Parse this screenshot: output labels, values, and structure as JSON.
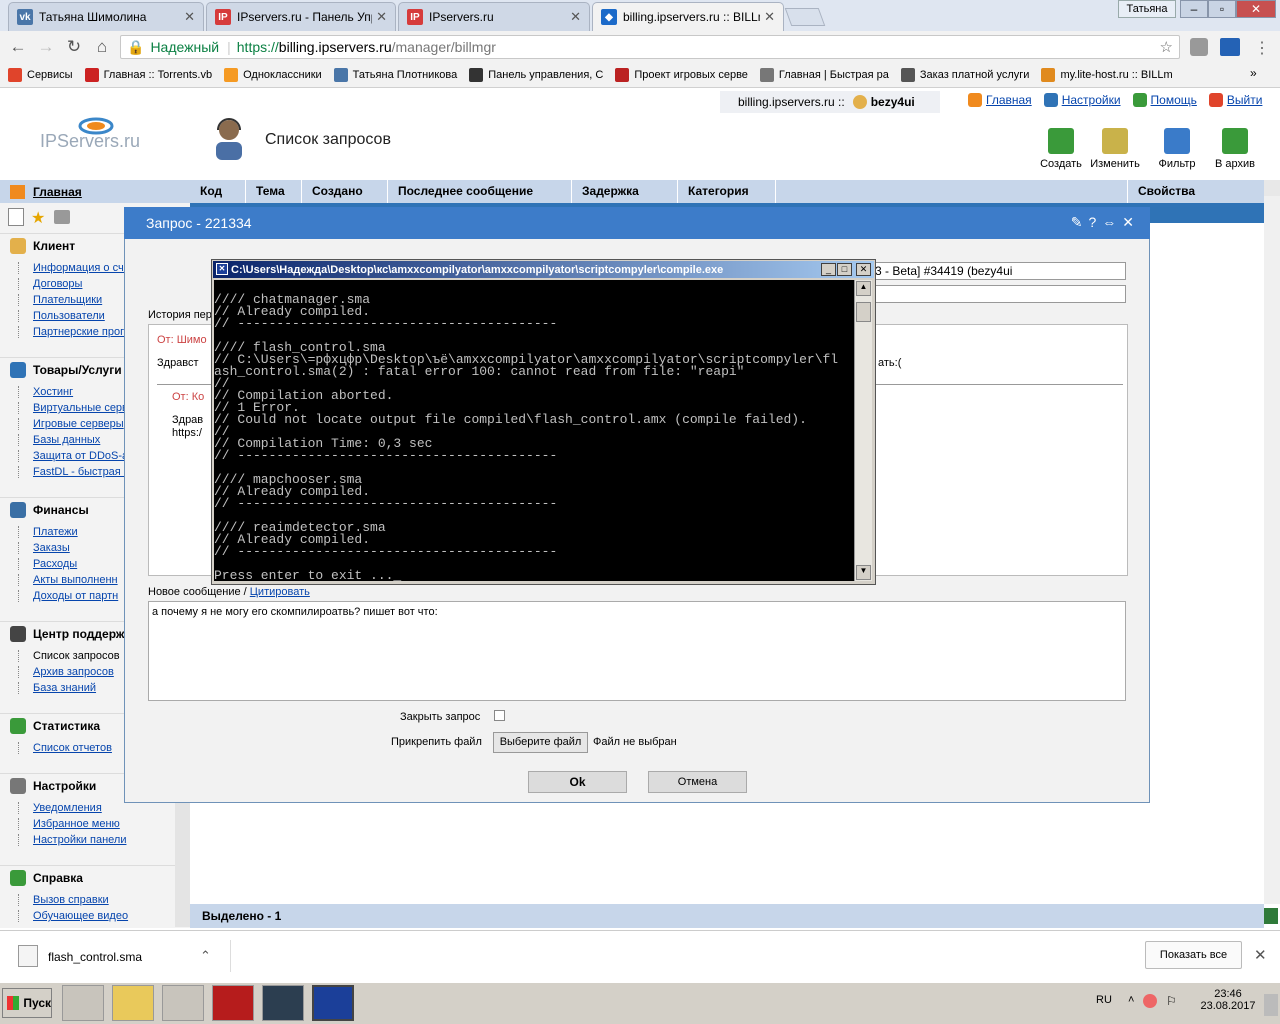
{
  "browser": {
    "tabs": [
      {
        "title": "Татьяна Шимолина",
        "color": "#4a76a8",
        "glyph": "vk"
      },
      {
        "title": "IPservers.ru - Панель Упра",
        "color": "#d63b3b",
        "glyph": "IP"
      },
      {
        "title": "IPservers.ru",
        "color": "#d63b3b",
        "glyph": "IP"
      },
      {
        "title": "billing.ipservers.ru :: BILLm",
        "color": "#1b6ac9",
        "glyph": "◆"
      }
    ],
    "window_user": "Татьяна",
    "url_secure": "Надежный",
    "url_scheme": "https://",
    "url_host": "billing.ipservers.ru",
    "url_path": "/manager/billmgr",
    "bookmarks": [
      {
        "label": "Сервисы",
        "color": "#e0442b"
      },
      {
        "label": "Главная :: Torrents.vb",
        "color": "#c22"
      },
      {
        "label": "Одноклассники",
        "color": "#f59a23"
      },
      {
        "label": "Татьяна Плотникова",
        "color": "#4a76a8"
      },
      {
        "label": "Панель управления, С",
        "color": "#333"
      },
      {
        "label": "Проект игровых серве",
        "color": "#b22"
      },
      {
        "label": "Главная | Быстрая ра",
        "color": "#777"
      },
      {
        "label": "Заказ платной услуги",
        "color": "#555"
      },
      {
        "label": "my.lite-host.ru :: BILLm",
        "color": "#e08a1e"
      }
    ]
  },
  "header": {
    "user_crumb": "billing.ipservers.ru ::",
    "user_name": "bezy4ui",
    "links": [
      "Главная",
      "Настройки",
      "Помощь",
      "Выйти"
    ],
    "logo_text": "IPServers.ru",
    "page_title": "Список запросов",
    "toolbar": [
      "Создать",
      "Изменить",
      "Фильтр",
      "В архив"
    ]
  },
  "sidebar": {
    "home": "Главная",
    "sections": [
      {
        "title": "Клиент",
        "items": [
          "Информация о сче",
          "Договоры",
          "Плательщики",
          "Пользователи",
          "Партнерские прог"
        ]
      },
      {
        "title": "Товары/Услуги",
        "items": [
          "Хостинг",
          "Виртуальные серв",
          "Игровые серверы",
          "Базы данных",
          "Защита от DDoS-а",
          "FastDL - быстрая з"
        ]
      },
      {
        "title": "Финансы",
        "items": [
          "Платежи",
          "Заказы",
          "Расходы",
          "Акты выполненн",
          "Доходы от партн"
        ]
      },
      {
        "title": "Центр поддерж",
        "items": [
          "Список запросов",
          "Архив запросов",
          "База знаний"
        ]
      },
      {
        "title": "Статистика",
        "items": [
          "Список отчетов"
        ]
      },
      {
        "title": "Настройки",
        "items": [
          "Уведомления",
          "Избранное меню",
          "Настройки панели"
        ]
      },
      {
        "title": "Справка",
        "items": [
          "Вызов справки",
          "Обучающее видео"
        ]
      }
    ]
  },
  "table": {
    "columns": [
      "Код",
      "Тема",
      "Создано",
      "Последнее сообщение",
      "Задержка",
      "Категория",
      "Свойства"
    ],
    "status": "Выделено - 1"
  },
  "modal": {
    "title": "Запрос - 221334",
    "subject_value": "3 - Beta] #34419 (bezy4ui",
    "history_label": "История пер",
    "hist_from1": "От: Шимо",
    "hist_greeting": "Здравст",
    "hist_tail": "ать:(",
    "hist_from2": "От: Ко",
    "hist_text1": "Здрав",
    "hist_text2": "https:/",
    "new_message_label": "Новое сообщение /",
    "quote_link": "Цитировать",
    "message_text": "а почему я не могу его скомпилироатвь? пишет вот что:",
    "close_label": "Закрыть запрос",
    "attach_label": "Прикрепить файл",
    "choose_file": "Выберите файл",
    "no_file": "Файл не выбран",
    "ok": "Ok",
    "cancel": "Отмена"
  },
  "console": {
    "title": "C:\\Users\\Надежда\\Desktop\\кс\\amxxcompilyator\\amxxcompilyator\\scriptcompyler\\compile.exe",
    "lines": [
      "//// chatmanager.sma",
      "// Already compiled.",
      "// -----------------------------------------",
      "",
      "//// flash_control.sma",
      "// C:\\Users\\=рфхцфр\\Desktop\\ъё\\amxxcompilyator\\amxxcompilyator\\scriptcompyler\\fl",
      "ash_control.sma(2) : fatal error 100: cannot read from file: \"reapi\"",
      "//",
      "// Compilation aborted.",
      "// 1 Error.",
      "// Could not locate output file compiled\\flash_control.amx (compile failed).",
      "//",
      "// Compilation Time: 0,3 sec",
      "// -----------------------------------------",
      "",
      "//// mapchooser.sma",
      "// Already compiled.",
      "// -----------------------------------------",
      "",
      "//// reaimdetector.sma",
      "// Already compiled.",
      "// -----------------------------------------",
      "",
      "Press enter to exit ..._"
    ]
  },
  "downloads": {
    "file": "flash_control.sma",
    "show_all": "Показать все"
  },
  "taskbar": {
    "start": "Пуск",
    "lang": "RU",
    "time": "23:46",
    "date": "23.08.2017"
  }
}
